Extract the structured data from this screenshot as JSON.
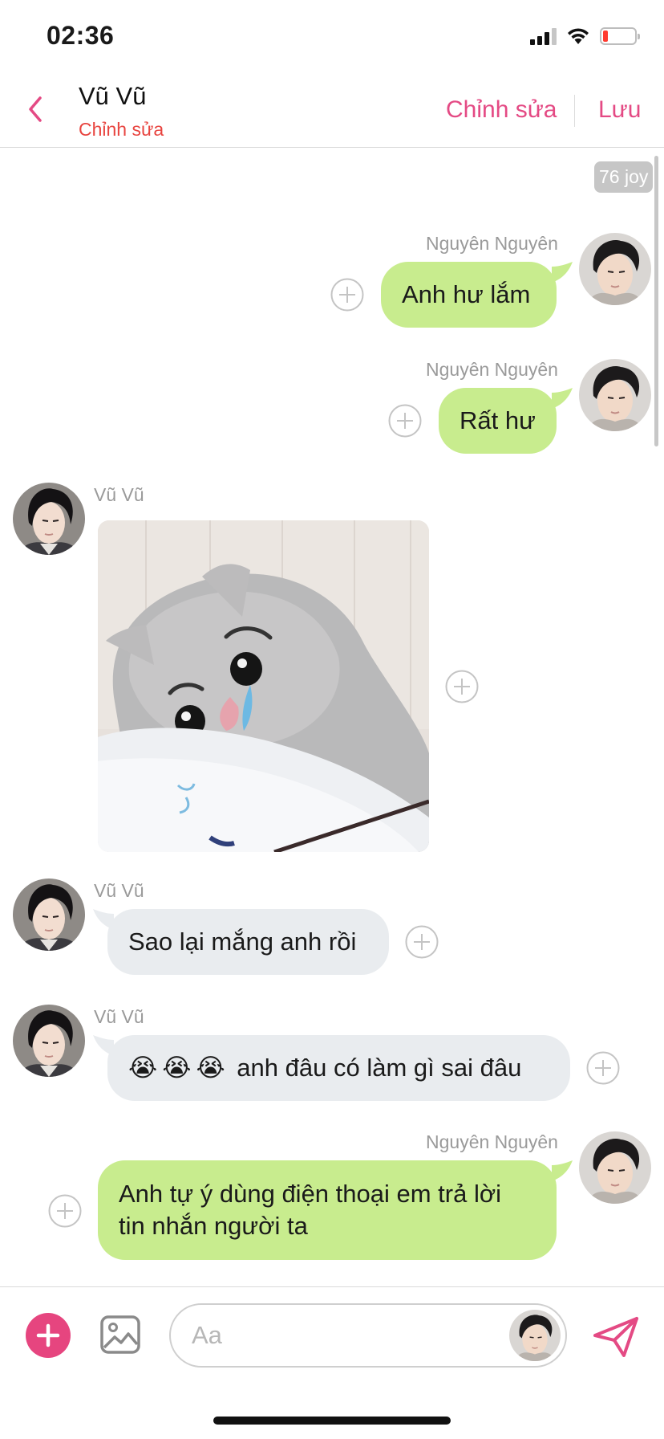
{
  "status_bar": {
    "time": "02:36",
    "battery_level": 0.15
  },
  "header": {
    "chat_name": "Vũ Vũ",
    "subtitle": "Chỉnh sửa",
    "edit_label": "Chỉnh sửa",
    "save_label": "Lưu"
  },
  "joy_badge": "76 joy",
  "messages": [
    {
      "sender": "Nguyên Nguyên",
      "direction": "sent",
      "type": "text",
      "text": "Anh hư lắm"
    },
    {
      "sender": "Nguyên Nguyên",
      "direction": "sent",
      "type": "text",
      "text": "Rất hư"
    },
    {
      "sender": "Vũ Vũ",
      "direction": "received",
      "type": "image",
      "image": "crying cat sticker"
    },
    {
      "sender": "Vũ Vũ",
      "direction": "received",
      "type": "text",
      "text": "Sao lại mắng anh rồi"
    },
    {
      "sender": "Vũ Vũ",
      "direction": "received",
      "type": "text",
      "emoji": "😭😭😭",
      "text": "anh đâu có làm gì sai đâu"
    },
    {
      "sender": "Nguyên Nguyên",
      "direction": "sent",
      "type": "text",
      "text_line1": "Anh tự ý dùng điện thoại em trả lời",
      "text_line2": "tin nhắn người ta"
    }
  ],
  "composer": {
    "placeholder": "Aa"
  },
  "colors": {
    "accent": "#e44a84",
    "sent_bubble": "#c8ec8e",
    "received_bubble": "#e9ecef",
    "subtitle": "#e8443f"
  },
  "icons": [
    "back-chevron-icon",
    "signal-icon",
    "wifi-icon",
    "battery-icon",
    "add-reaction-icon",
    "plus-circle-icon",
    "image-icon",
    "send-icon"
  ]
}
